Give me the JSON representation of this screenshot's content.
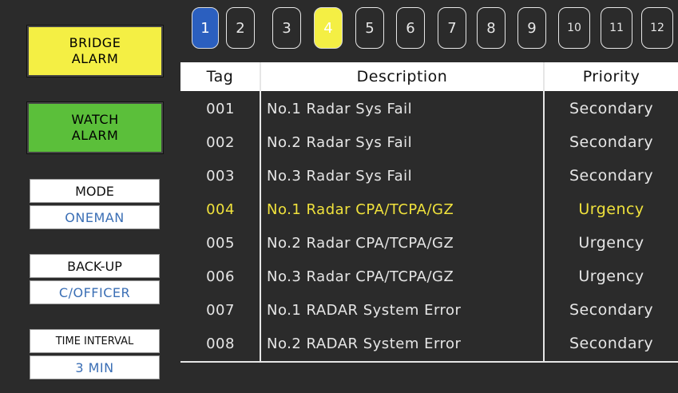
{
  "left_panel": {
    "bridge_alarm": {
      "line1": "BRIDGE",
      "line2": "ALARM"
    },
    "watch_alarm": {
      "line1": "WATCH",
      "line2": "ALARM"
    },
    "mode": {
      "label": "MODE",
      "value": "ONEMAN"
    },
    "backup": {
      "label": "BACK-UP",
      "value": "C/OFFICER"
    },
    "time_interval": {
      "label": "TIME INTERVAL",
      "value": "3 MIN"
    }
  },
  "tabs": [
    "1",
    "2",
    "3",
    "4",
    "5",
    "6",
    "7",
    "8",
    "9",
    "10",
    "11",
    "12"
  ],
  "table": {
    "headers": {
      "tag": "Tag",
      "description": "Description",
      "priority": "Priority"
    },
    "rows": [
      {
        "tag": "001",
        "description": "No.1 Radar Sys Fail",
        "priority": "Secondary"
      },
      {
        "tag": "002",
        "description": "No.2 Radar Sys Fail",
        "priority": "Secondary"
      },
      {
        "tag": "003",
        "description": "No.3 Radar Sys Fail",
        "priority": "Secondary"
      },
      {
        "tag": "004",
        "description": "No.1 Radar CPA/TCPA/GZ",
        "priority": "Urgency"
      },
      {
        "tag": "005",
        "description": "No.2 Radar CPA/TCPA/GZ",
        "priority": "Urgency"
      },
      {
        "tag": "006",
        "description": "No.3 Radar CPA/TCPA/GZ",
        "priority": "Urgency"
      },
      {
        "tag": "007",
        "description": "No.1 RADAR System Error",
        "priority": "Secondary"
      },
      {
        "tag": "008",
        "description": "No.2 RADAR System Error",
        "priority": "Secondary"
      }
    ]
  },
  "colors": {
    "background": "#2b2b2b",
    "bridge_alarm": "#f4ef44",
    "watch_alarm": "#5bbf3a",
    "active_tab_blue": "#2b5fbf",
    "active_tab_yellow": "#f4ef44",
    "highlight_text": "#f0e23c",
    "value_text": "#3b6fb5"
  }
}
